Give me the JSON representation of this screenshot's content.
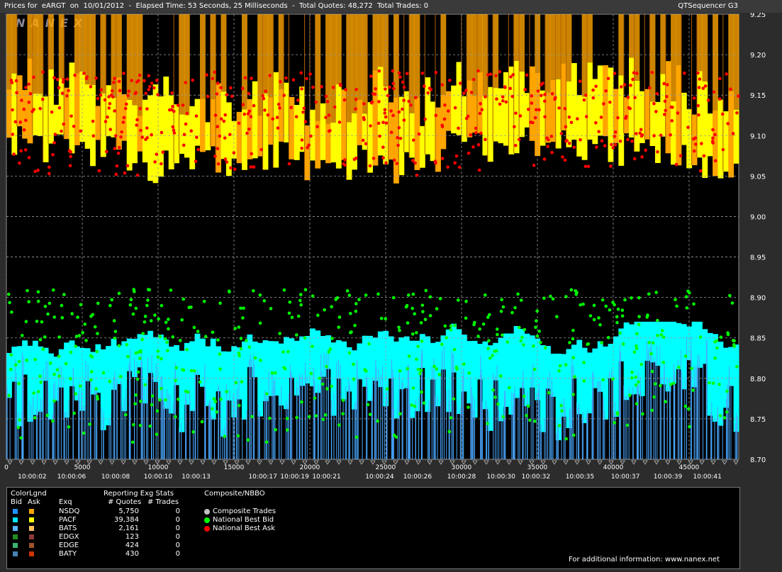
{
  "header": {
    "title_left": "Prices for  eARGT  on  10/01/2012  -  Elapsed Time: 53 Seconds, 25 Milliseconds  -  Total Quotes: 48,272  Total Trades: 0",
    "title_right": "QTSequencer G3"
  },
  "watermark": "NANEX",
  "chart_data": {
    "type": "scatter",
    "y_ticks": [
      "9.25",
      "9.20",
      "9.15",
      "9.10",
      "9.05",
      "9.00",
      "8.95",
      "8.90",
      "8.85",
      "8.80",
      "8.75",
      "8.70"
    ],
    "ylim": [
      8.7,
      9.25
    ],
    "xlim": [
      0,
      48272
    ],
    "x_ticks": [
      "0",
      "5000",
      "10000",
      "15000",
      "20000",
      "25000",
      "30000",
      "35000",
      "40000",
      "45000"
    ],
    "x_tick_values": [
      0,
      5000,
      10000,
      15000,
      20000,
      25000,
      30000,
      35000,
      40000,
      45000
    ],
    "time_labels": [
      "10:00:02",
      "10:00:06",
      "10:00:08",
      "10:00:10",
      "10:00:13",
      "10:00:17",
      "10:00:19",
      "10:00:21",
      "10:00:24",
      "10:00:26",
      "10:00:28",
      "10:00:30",
      "10:00:32",
      "10:00:35",
      "10:00:37",
      "10:00:39",
      "10:00:41"
    ],
    "time_label_values": [
      1700,
      4300,
      7200,
      10000,
      12500,
      16900,
      19000,
      21100,
      24600,
      27100,
      30000,
      32600,
      34900,
      37800,
      40800,
      43600,
      46200
    ],
    "series": [
      {
        "name": "National Best Bid",
        "color": "#00ff00",
        "range": [
          8.72,
          8.91
        ]
      },
      {
        "name": "National Best Ask",
        "color": "#ff0000",
        "range": [
          9.05,
          9.18
        ]
      }
    ],
    "grid": true
  },
  "legend": {
    "heading_colorlgnd": "ColorLgnd",
    "heading_bid": "Bid",
    "heading_ask": "Ask",
    "heading_exq": "Exq",
    "heading_reporting": "Reporting Exg Stats",
    "heading_quotes": "# Quotes",
    "heading_trades": "# Trades",
    "heading_composite": "Composite/NBBO",
    "exchanges": [
      {
        "name": "NSDQ",
        "quotes": "5,750",
        "trades": "0",
        "bid_color": "#1e90ff",
        "ask_color": "#ffa500"
      },
      {
        "name": "PACF",
        "quotes": "39,384",
        "trades": "0",
        "bid_color": "#00e5ff",
        "ask_color": "#ffff00"
      },
      {
        "name": "BATS",
        "quotes": "2,161",
        "trades": "0",
        "bid_color": "#5ab4ff",
        "ask_color": "#ffc060"
      },
      {
        "name": "EDGX",
        "quotes": "123",
        "trades": "0",
        "bid_color": "#228b22",
        "ask_color": "#8b3a3a"
      },
      {
        "name": "EDGE",
        "quotes": "424",
        "trades": "0",
        "bid_color": "#3cb371",
        "ask_color": "#a0522d"
      },
      {
        "name": "BATY",
        "quotes": "430",
        "trades": "0",
        "bid_color": "#4682b4",
        "ask_color": "#cd3300"
      }
    ],
    "composite": [
      {
        "label": "Composite Trades",
        "color": "#c0c0c0"
      },
      {
        "label": "National Best Bid",
        "color": "#00ff00"
      },
      {
        "label": "National Best Ask",
        "color": "#ff0000"
      }
    ],
    "footer": "For additional information: www.nanex.net"
  }
}
